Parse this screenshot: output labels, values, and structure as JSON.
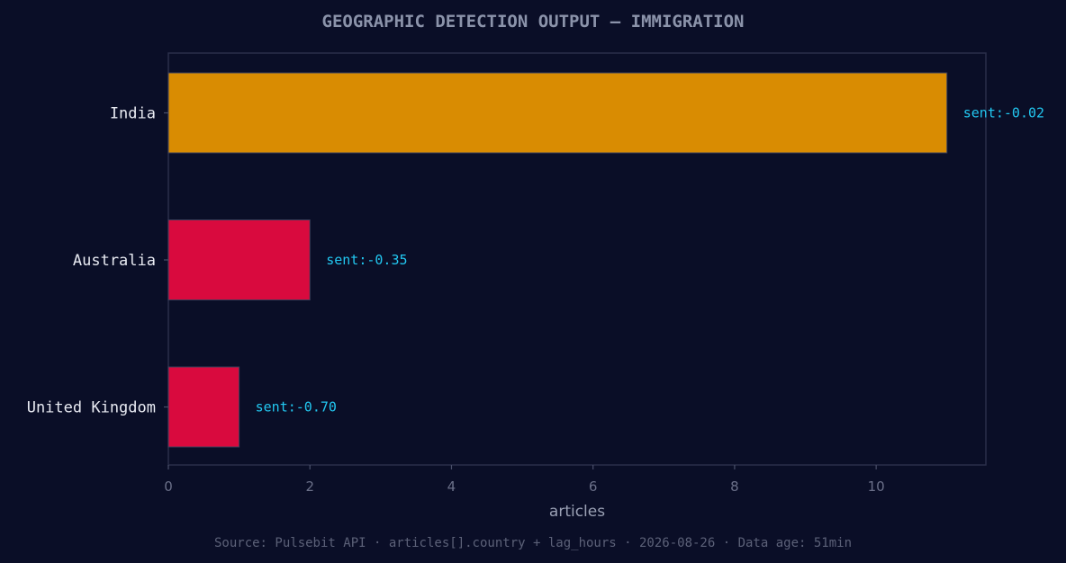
{
  "chart_data": {
    "type": "bar",
    "orientation": "horizontal",
    "title": "GEOGRAPHIC DETECTION OUTPUT — IMMIGRATION",
    "xlabel": "articles",
    "ylabel": "",
    "xlim": [
      0,
      11.55
    ],
    "xticks": [
      0,
      2,
      4,
      6,
      8,
      10
    ],
    "grid": false,
    "categories": [
      "India",
      "Australia",
      "United Kingdom"
    ],
    "values": [
      11,
      2,
      1
    ],
    "data_labels": [
      "sent:-0.02",
      "sent:-0.35",
      "sent:-0.70"
    ],
    "bar_colors": [
      "#d98c02",
      "#d90a3e",
      "#d90a3e"
    ],
    "label_color": "#22c7f0",
    "source": "Source: Pulsebit API · articles[].country + lag_hours · 2026-08-26 · Data age: 51min"
  },
  "colors": {
    "background": "#0a0e27",
    "frame": "#2a2f4a",
    "positive": "#d98c02",
    "negative": "#d90a3e",
    "accent": "#22c7f0"
  }
}
